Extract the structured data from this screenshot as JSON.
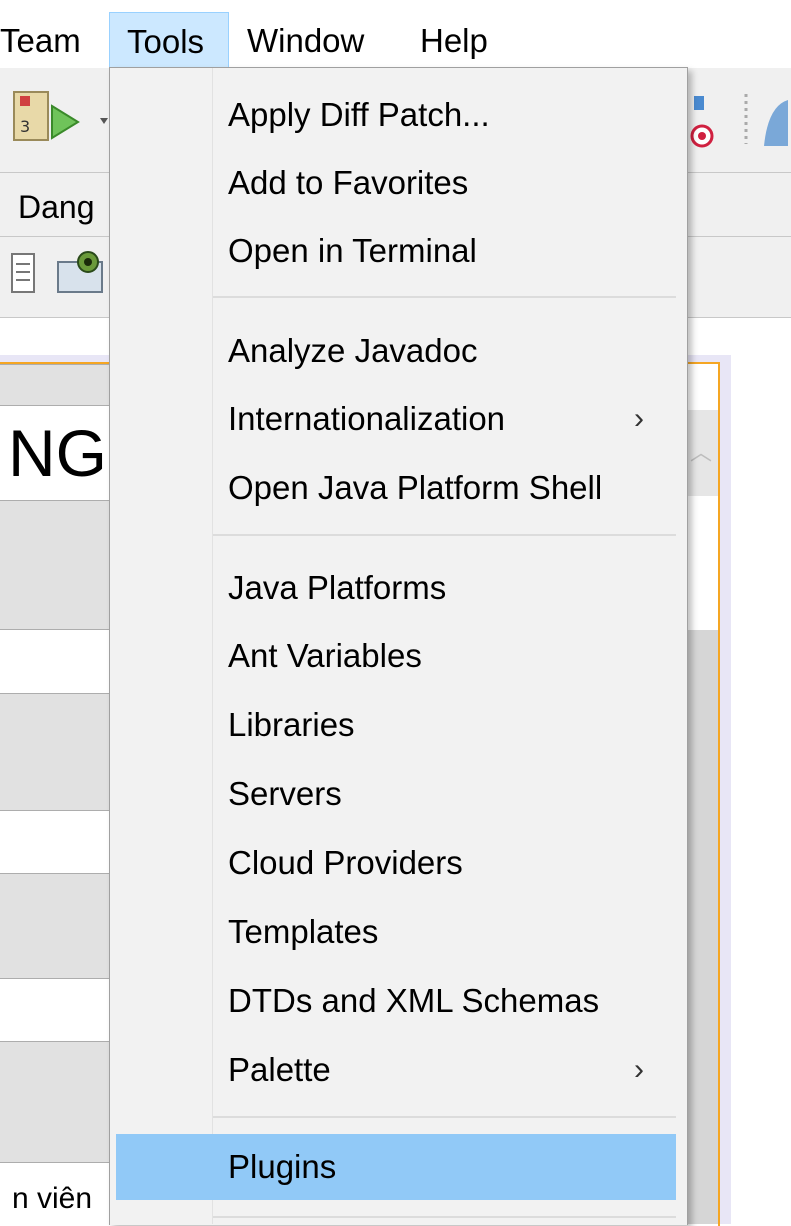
{
  "menubar": {
    "items": [
      {
        "label": "Team"
      },
      {
        "label": "Tools"
      },
      {
        "label": "Window"
      },
      {
        "label": "Help"
      }
    ]
  },
  "toolbar": {
    "partial_label": "Dang"
  },
  "background": {
    "heading_fragment": "NG",
    "bottom_label_fragment": "n viên"
  },
  "tools_menu": {
    "groups": [
      {
        "items": [
          {
            "label": "Apply Diff Patch...",
            "submenu": false
          },
          {
            "label": "Add to Favorites",
            "submenu": false
          },
          {
            "label": "Open in Terminal",
            "submenu": false
          }
        ]
      },
      {
        "items": [
          {
            "label": "Analyze Javadoc",
            "submenu": false
          },
          {
            "label": "Internationalization",
            "submenu": true
          },
          {
            "label": "Open Java Platform Shell",
            "submenu": false
          }
        ]
      },
      {
        "items": [
          {
            "label": "Java Platforms",
            "submenu": false
          },
          {
            "label": "Ant Variables",
            "submenu": false
          },
          {
            "label": "Libraries",
            "submenu": false
          },
          {
            "label": "Servers",
            "submenu": false
          },
          {
            "label": "Cloud Providers",
            "submenu": false
          },
          {
            "label": "Templates",
            "submenu": false
          },
          {
            "label": "DTDs and XML Schemas",
            "submenu": false
          },
          {
            "label": "Palette",
            "submenu": true
          }
        ]
      },
      {
        "items": [
          {
            "label": "Plugins",
            "submenu": false,
            "highlighted": true
          }
        ]
      }
    ],
    "submenu_glyph": "›"
  },
  "colors": {
    "menu_bg": "#f2f2f2",
    "highlight": "#91c9f7",
    "active_menu": "#cce8ff",
    "accent_border": "#f5a623"
  }
}
